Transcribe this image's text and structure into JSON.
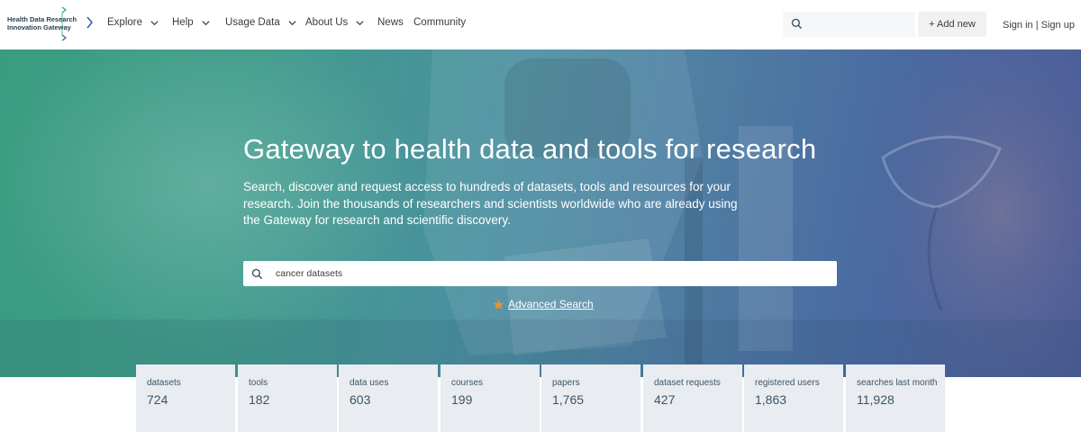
{
  "logo": {
    "line1": "Health Data Research",
    "line2": "Innovation Gateway"
  },
  "nav": {
    "explore": "Explore",
    "help": "Help",
    "usage_data": "Usage Data",
    "about_us": "About Us",
    "news": "News",
    "community": "Community"
  },
  "header_search": {
    "value": "",
    "placeholder": ""
  },
  "add_new": "+ Add new",
  "auth": {
    "sign_in": "Sign in",
    "separator": " | ",
    "sign_up": "Sign up"
  },
  "hero": {
    "title": "Gateway to health data and tools for research",
    "description": "Search, discover and request access to hundreds of datasets, tools and resources for your research. Join the thousands of researchers and scientists worldwide who are already using the Gateway for research and scientific discovery.",
    "search_value": "cancer datasets",
    "advanced_search": "Advanced Search"
  },
  "stats": [
    {
      "label": "datasets",
      "value": "724"
    },
    {
      "label": "tools",
      "value": "182"
    },
    {
      "label": "data uses",
      "value": "603"
    },
    {
      "label": "courses",
      "value": "199"
    },
    {
      "label": "papers",
      "value": "1,765"
    },
    {
      "label": "dataset requests",
      "value": "427"
    },
    {
      "label": "registered users",
      "value": "1,863"
    },
    {
      "label": "searches last month",
      "value": "11,928"
    }
  ],
  "colors": {
    "accent": "#e8912c",
    "stat_bg": "#e9ecf0",
    "hero_start": "#3a9c7f",
    "hero_end": "#4d5c98"
  },
  "icons": [
    "logo-mark",
    "chevron-down-icon",
    "search-icon",
    "star-icon"
  ]
}
